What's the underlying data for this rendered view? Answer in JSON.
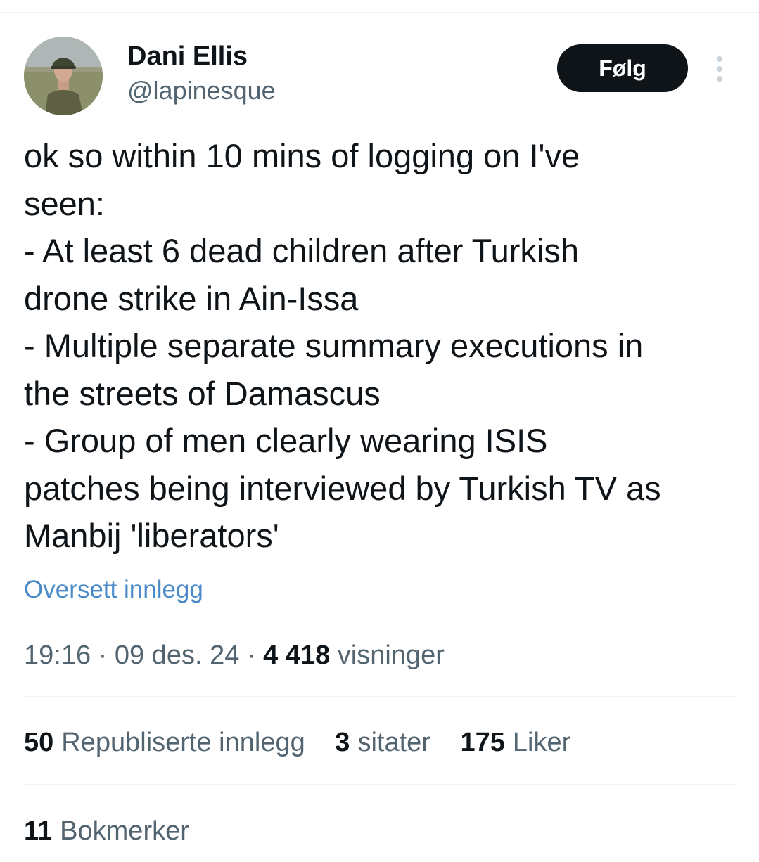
{
  "author": {
    "name": "Dani Ellis",
    "handle": "@lapinesque"
  },
  "header": {
    "follow_label": "Følg",
    "more_icon": "more-vertical-icon"
  },
  "tweet": {
    "lines": [
      "ok so within 10 mins of logging on I've",
      "seen:",
      "- At least 6 dead children after Turkish",
      "drone strike in Ain-Issa",
      "- Multiple separate summary executions in",
      "the streets of Damascus",
      "- Group of men clearly wearing ISIS",
      "patches being interviewed by Turkish TV as",
      "Manbij 'liberators'"
    ],
    "translate_label": "Oversett innlegg"
  },
  "meta": {
    "time": "19:16",
    "separator": "·",
    "date": "09 des. 24",
    "views_count": "4 418",
    "views_label": "visninger"
  },
  "stats": {
    "reposts_count": "50",
    "reposts_label": "Republiserte innlegg",
    "quotes_count": "3",
    "quotes_label": "sitater",
    "likes_count": "175",
    "likes_label": "Liker",
    "bookmarks_count": "11",
    "bookmarks_label": "Bokmerker"
  },
  "colors": {
    "text_primary": "#0f1419",
    "text_secondary": "#536471",
    "link": "#4a8ac9",
    "divider": "#eff3f4",
    "follow_bg": "#0f1419"
  }
}
